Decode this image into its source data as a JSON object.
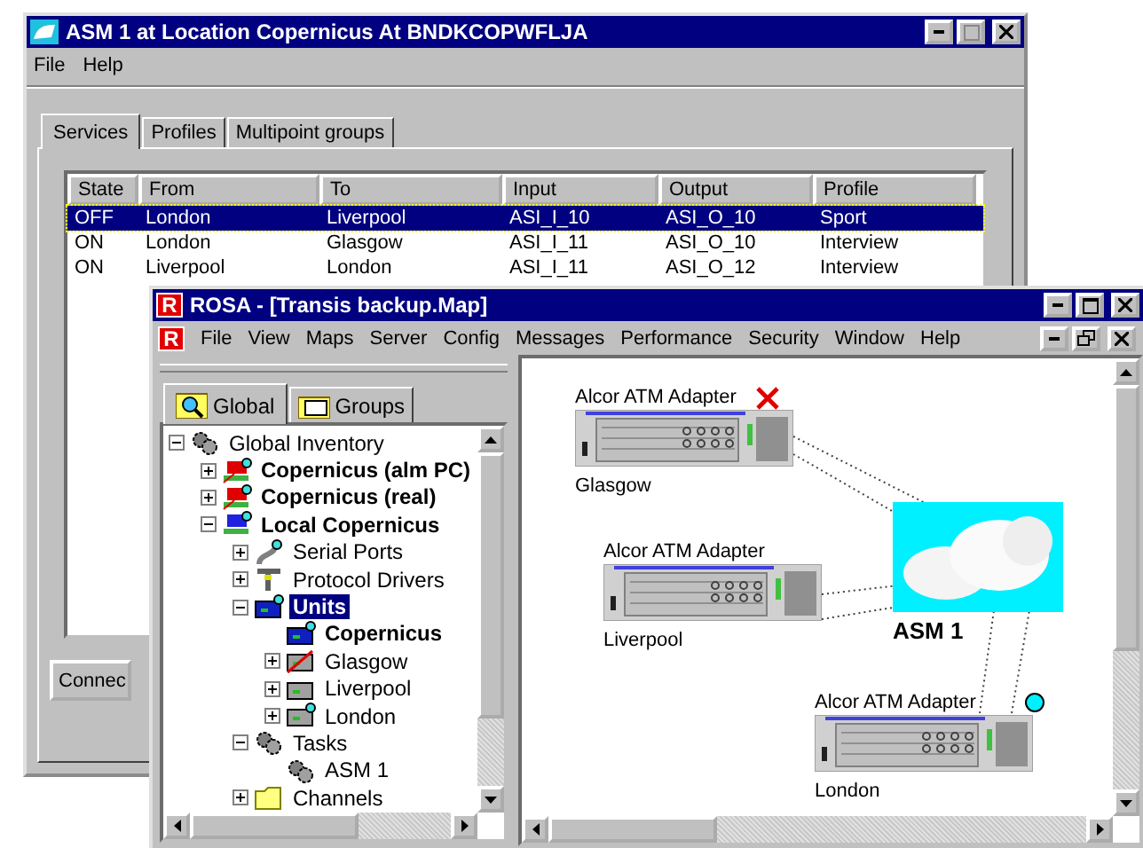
{
  "back_window": {
    "title": "ASM 1 at Location Copernicus At BNDKCOPWFLJA",
    "menu": [
      "File",
      "Help"
    ],
    "tabs": [
      {
        "label": "Services",
        "selected": true
      },
      {
        "label": "Profiles",
        "selected": false
      },
      {
        "label": "Multipoint groups",
        "selected": false
      }
    ],
    "table": {
      "columns": [
        "State",
        "From",
        "To",
        "Input",
        "Output",
        "Profile"
      ],
      "rows": [
        {
          "cells": [
            "OFF",
            "London",
            "Liverpool",
            "ASI_I_10",
            "ASI_O_10",
            "Sport"
          ],
          "selected": true
        },
        {
          "cells": [
            "ON",
            "London",
            "Glasgow",
            "ASI_I_11",
            "ASI_O_10",
            "Interview"
          ],
          "selected": false
        },
        {
          "cells": [
            "ON",
            "Liverpool",
            "London",
            "ASI_I_11",
            "ASI_O_12",
            "Interview"
          ],
          "selected": false
        }
      ]
    },
    "button": "Connec"
  },
  "front_window": {
    "icon_letter": "R",
    "title": "ROSA - [Transis backup.Map]",
    "menu_icon_letter": "R",
    "menu": [
      "File",
      "View",
      "Maps",
      "Server",
      "Config",
      "Messages",
      "Performance",
      "Security",
      "Window",
      "Help"
    ],
    "tabs": [
      {
        "label": "Global",
        "selected": true
      },
      {
        "label": "Groups",
        "selected": false
      }
    ],
    "tree": [
      {
        "label": "Global Inventory",
        "kind": "inventory",
        "bold": false,
        "selected": false,
        "expanded": true,
        "children": [
          {
            "label": "Copernicus (alm PC)",
            "kind": "site-alarm",
            "bold": true,
            "selected": false,
            "expanded": false
          },
          {
            "label": "Copernicus (real)",
            "kind": "site-alarm",
            "bold": true,
            "selected": false,
            "expanded": false
          },
          {
            "label": "Local Copernicus",
            "kind": "site",
            "bold": true,
            "selected": false,
            "expanded": true,
            "children": [
              {
                "label": "Serial Ports",
                "kind": "serial",
                "bold": false,
                "selected": false,
                "expanded": false
              },
              {
                "label": "Protocol Drivers",
                "kind": "protocol",
                "bold": false,
                "selected": false,
                "expanded": false
              },
              {
                "label": "Units",
                "kind": "unit-flag",
                "bold": true,
                "selected": true,
                "expanded": true,
                "children": [
                  {
                    "label": "Copernicus",
                    "kind": "unit-blue",
                    "bold": true,
                    "selected": false
                  },
                  {
                    "label": "Glasgow",
                    "kind": "unit-down",
                    "bold": false,
                    "selected": false,
                    "expanded": false
                  },
                  {
                    "label": "Liverpool",
                    "kind": "unit",
                    "bold": false,
                    "selected": false,
                    "expanded": false
                  },
                  {
                    "label": "London",
                    "kind": "unit-flag-grey",
                    "bold": false,
                    "selected": false,
                    "expanded": false
                  }
                ]
              },
              {
                "label": "Tasks",
                "kind": "tasks",
                "bold": false,
                "selected": false,
                "expanded": true,
                "children": [
                  {
                    "label": "ASM 1",
                    "kind": "tasks",
                    "bold": false,
                    "selected": false
                  }
                ]
              },
              {
                "label": "Channels",
                "kind": "folder",
                "bold": false,
                "selected": false,
                "expanded": false
              }
            ]
          }
        ]
      }
    ],
    "map": {
      "nodes": [
        {
          "title": "Alcor ATM Adapter",
          "name": "Glasgow",
          "alarm": true,
          "active": false
        },
        {
          "title": "Alcor ATM Adapter",
          "name": "Liverpool",
          "alarm": false,
          "active": false
        },
        {
          "title": "Alcor ATM Adapter",
          "name": "London",
          "alarm": false,
          "active": true
        }
      ],
      "network": {
        "label": "ASM 1"
      }
    }
  }
}
